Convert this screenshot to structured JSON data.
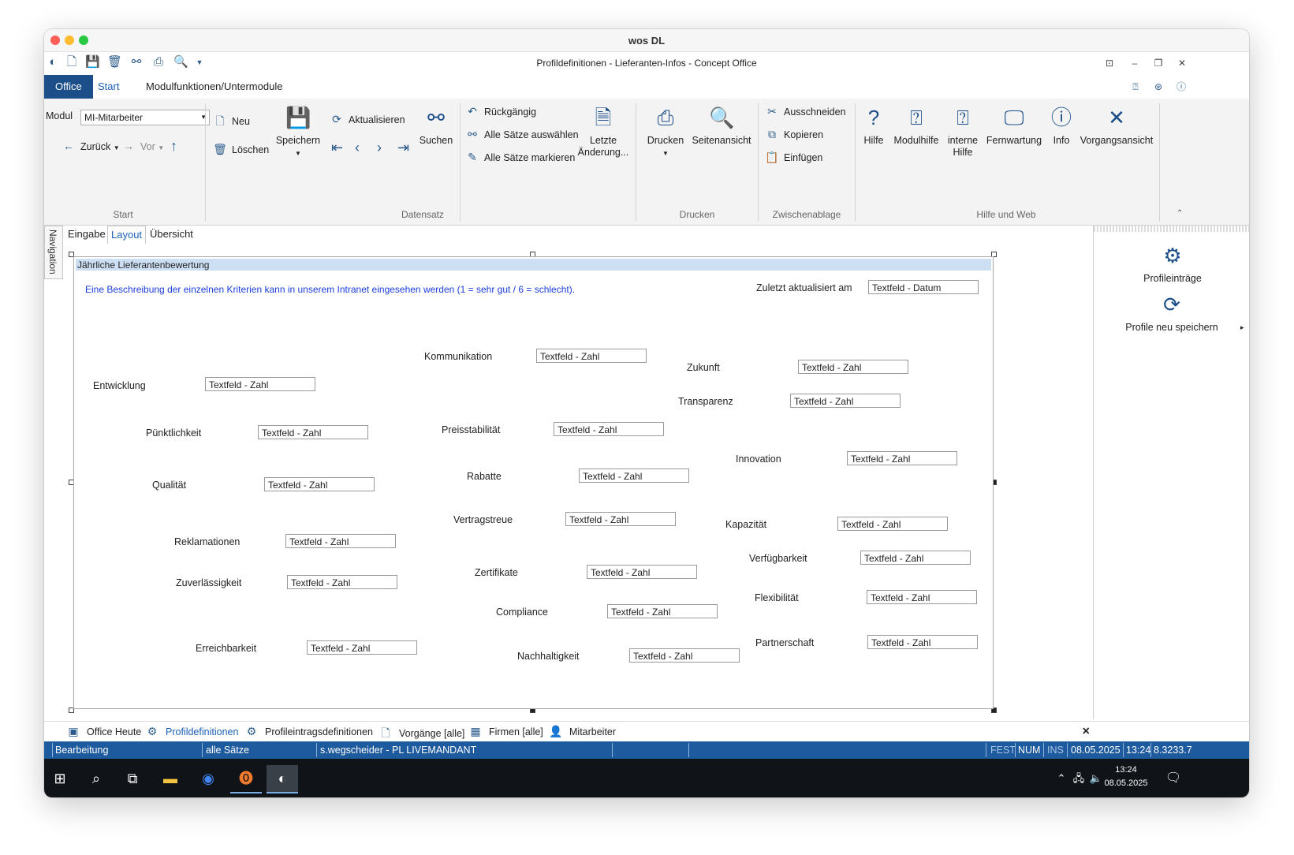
{
  "window": {
    "mac_title": "wos DL",
    "app_title": "Profildefinitionen - Lieferanten-Infos - Concept Office"
  },
  "colors": {
    "accent": "#1c4f8a",
    "statusbar": "#1e5a9e",
    "description": "#1b3ee0",
    "panel_header": "#cde0f3"
  },
  "ribbon_tabs": [
    "Office",
    "Start",
    "Modulfunktionen/Untermodule"
  ],
  "ribbon": {
    "modul_label": "Modul",
    "modul_value": "MI-Mitarbeiter",
    "back": "Zurück",
    "forward": "Vor",
    "group_start": "Start",
    "neu": "Neu",
    "loeschen": "Löschen",
    "speichern": "Speichern",
    "aktualisieren": "Aktualisieren",
    "suchen": "Suchen",
    "rueckgaengig": "Rückgängig",
    "alle_auswaehlen": "Alle Sätze auswählen",
    "alle_markieren": "Alle Sätze markieren",
    "letzte_aenderung_1": "Letzte",
    "letzte_aenderung_2": "Änderung...",
    "group_datensatz": "Datensatz",
    "drucken": "Drucken",
    "seitenansicht": "Seitenansicht",
    "group_drucken": "Drucken",
    "ausschneiden": "Ausschneiden",
    "kopieren": "Kopieren",
    "einfuegen": "Einfügen",
    "group_zwischenablage": "Zwischenablage",
    "hilfe": "Hilfe",
    "modulhilfe": "Modulhilfe",
    "interne_hilfe_1": "interne",
    "interne_hilfe_2": "Hilfe",
    "fernwartung": "Fernwartung",
    "info": "Info",
    "vorgangsansicht": "Vorgangsansicht",
    "group_hilfe": "Hilfe und Web"
  },
  "navigation_label": "Navigation",
  "subtabs": [
    "Eingabe",
    "Layout",
    "Übersicht"
  ],
  "form": {
    "header": "Jährliche Lieferantenbewertung",
    "description": "Eine Beschreibung der einzelnen Kriterien kann in unserem Intranet eingesehen werden (1 = sehr gut / 6 = schlecht).",
    "updated_label": "Zuletzt aktualisiert am",
    "updated_field": "Textfeld - Datum",
    "number_field": "Textfeld - Zahl",
    "criteria": [
      "Kommunikation",
      "Zukunft",
      "Entwicklung",
      "Transparenz",
      "Pünktlichkeit",
      "Preisstabilität",
      "Innovation",
      "Qualität",
      "Rabatte",
      "Vertragstreue",
      "Kapazität",
      "Reklamationen",
      "Verfügbarkeit",
      "Zuverlässigkeit",
      "Zertifikate",
      "Flexibilität",
      "Compliance",
      "Erreichbarkeit",
      "Partnerschaft",
      "Nachhaltigkeit"
    ]
  },
  "right_panel": {
    "profileintraege": "Profileinträge",
    "profile_speichern": "Profile neu speichern"
  },
  "bottom_tabs": [
    "Office Heute",
    "Profildefinitionen",
    "Profileintragsdefinitionen",
    "Vorgänge [alle]",
    "Firmen [alle]",
    "Mitarbeiter"
  ],
  "status": {
    "mode": "Bearbeitung",
    "records": "alle Sätze",
    "user": "s.wegscheider - PL LIVEMANDANT",
    "fest": "FEST",
    "num": "NUM",
    "ins": "INS",
    "date": "08.05.2025",
    "time": "13:24",
    "version": "8.3233.7"
  },
  "taskbar": {
    "time": "13:24",
    "date": "08.05.2025"
  }
}
